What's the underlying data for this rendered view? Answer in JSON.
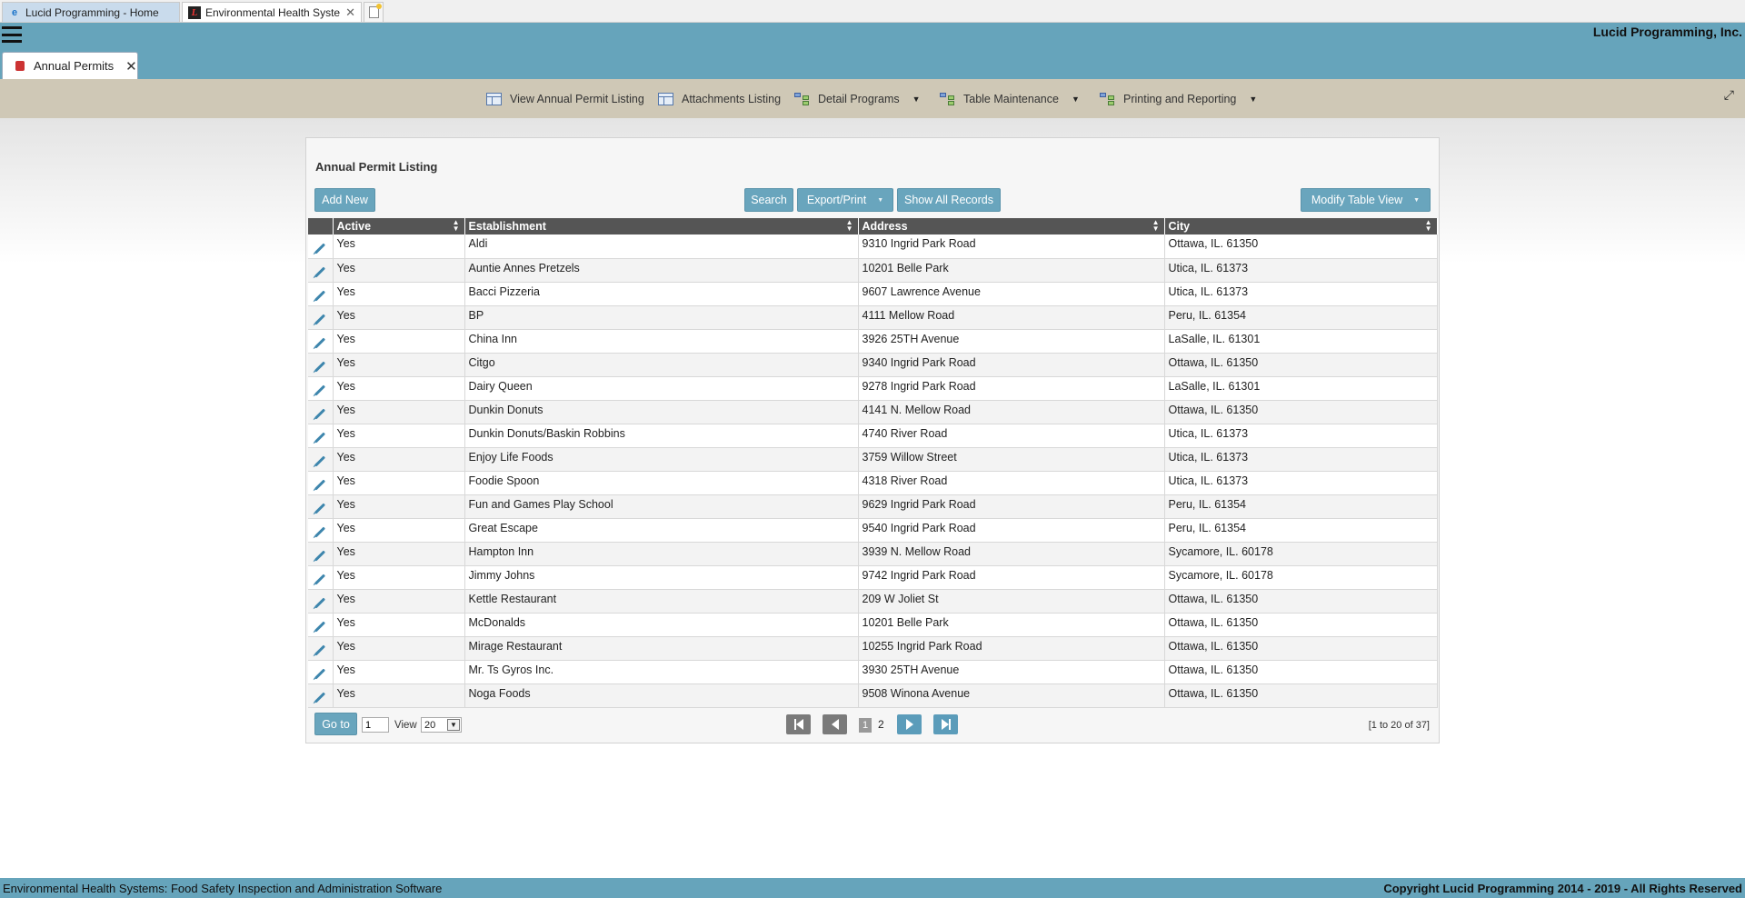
{
  "browser": {
    "tabs": [
      {
        "title": "Lucid Programming - Home"
      },
      {
        "title": "Environmental Health Syste..."
      }
    ]
  },
  "header": {
    "company": "Lucid Programming, Inc.",
    "page_tab": "Annual Permits"
  },
  "menu": {
    "items": [
      {
        "label": "View Annual Permit Listing",
        "icon": "table-icon"
      },
      {
        "label": "Attachments Listing",
        "icon": "table-icon"
      },
      {
        "label": "Detail Programs",
        "icon": "tree-icon",
        "dropdown": true
      },
      {
        "label": "Table Maintenance",
        "icon": "tree-icon",
        "dropdown": true
      },
      {
        "label": "Printing and Reporting",
        "icon": "tree-icon",
        "dropdown": true
      }
    ]
  },
  "panel": {
    "title": "Annual Permit Listing",
    "buttons": {
      "add_new": "Add New",
      "search": "Search",
      "export_print": "Export/Print",
      "show_all": "Show All Records",
      "modify_view": "Modify Table View"
    },
    "columns": [
      "Active",
      "Establishment",
      "Address",
      "City"
    ],
    "rows": [
      {
        "active": "Yes",
        "establishment": "Aldi",
        "address": "9310 Ingrid Park Road",
        "city": "Ottawa, IL. 61350"
      },
      {
        "active": "Yes",
        "establishment": "Auntie Annes Pretzels",
        "address": "10201 Belle Park",
        "city": "Utica, IL. 61373"
      },
      {
        "active": "Yes",
        "establishment": "Bacci Pizzeria",
        "address": "9607 Lawrence Avenue",
        "city": "Utica, IL. 61373"
      },
      {
        "active": "Yes",
        "establishment": "BP",
        "address": "4111 Mellow Road",
        "city": "Peru, IL. 61354"
      },
      {
        "active": "Yes",
        "establishment": "China Inn",
        "address": "3926 25TH Avenue",
        "city": "LaSalle, IL. 61301"
      },
      {
        "active": "Yes",
        "establishment": "Citgo",
        "address": "9340 Ingrid Park Road",
        "city": "Ottawa, IL. 61350"
      },
      {
        "active": "Yes",
        "establishment": "Dairy Queen",
        "address": "9278 Ingrid Park Road",
        "city": "LaSalle, IL. 61301"
      },
      {
        "active": "Yes",
        "establishment": "Dunkin Donuts",
        "address": "4141 N. Mellow Road",
        "city": "Ottawa, IL. 61350"
      },
      {
        "active": "Yes",
        "establishment": "Dunkin Donuts/Baskin Robbins",
        "address": "4740 River Road",
        "city": "Utica, IL. 61373"
      },
      {
        "active": "Yes",
        "establishment": "Enjoy Life Foods",
        "address": "3759 Willow Street",
        "city": "Utica, IL. 61373"
      },
      {
        "active": "Yes",
        "establishment": "Foodie Spoon",
        "address": "4318 River Road",
        "city": "Utica, IL. 61373"
      },
      {
        "active": "Yes",
        "establishment": "Fun and Games Play School",
        "address": "9629 Ingrid Park Road",
        "city": "Peru, IL. 61354"
      },
      {
        "active": "Yes",
        "establishment": "Great Escape",
        "address": "9540 Ingrid Park Road",
        "city": "Peru, IL. 61354"
      },
      {
        "active": "Yes",
        "establishment": "Hampton Inn",
        "address": "3939 N. Mellow Road",
        "city": "Sycamore, IL. 60178"
      },
      {
        "active": "Yes",
        "establishment": "Jimmy Johns",
        "address": "9742 Ingrid Park Road",
        "city": "Sycamore, IL. 60178"
      },
      {
        "active": "Yes",
        "establishment": "Kettle Restaurant",
        "address": "209 W Joliet St",
        "city": "Ottawa, IL. 61350"
      },
      {
        "active": "Yes",
        "establishment": "McDonalds",
        "address": "10201 Belle Park",
        "city": "Ottawa, IL. 61350"
      },
      {
        "active": "Yes",
        "establishment": "Mirage Restaurant",
        "address": "10255 Ingrid Park Road",
        "city": "Ottawa, IL. 61350"
      },
      {
        "active": "Yes",
        "establishment": "Mr. Ts Gyros Inc.",
        "address": "3930 25TH Avenue",
        "city": "Ottawa, IL. 61350"
      },
      {
        "active": "Yes",
        "establishment": "Noga Foods",
        "address": "9508 Winona Avenue",
        "city": "Ottawa, IL. 61350"
      }
    ],
    "pager": {
      "goto_label": "Go to",
      "goto_value": "1",
      "view_label": "View",
      "view_value": "20",
      "current_page": "1",
      "next_page": "2",
      "info": "[1 to 20 of 37]"
    }
  },
  "footer": {
    "left": "Environmental Health Systems: Food Safety Inspection and Administration Software",
    "right": "Copyright Lucid Programming 2014 - 2019 - All Rights Reserved"
  },
  "colors": {
    "header": "#66a4bb",
    "menubar": "#cfc8b6",
    "button": "#69a5bd",
    "grid_header": "#555555"
  }
}
